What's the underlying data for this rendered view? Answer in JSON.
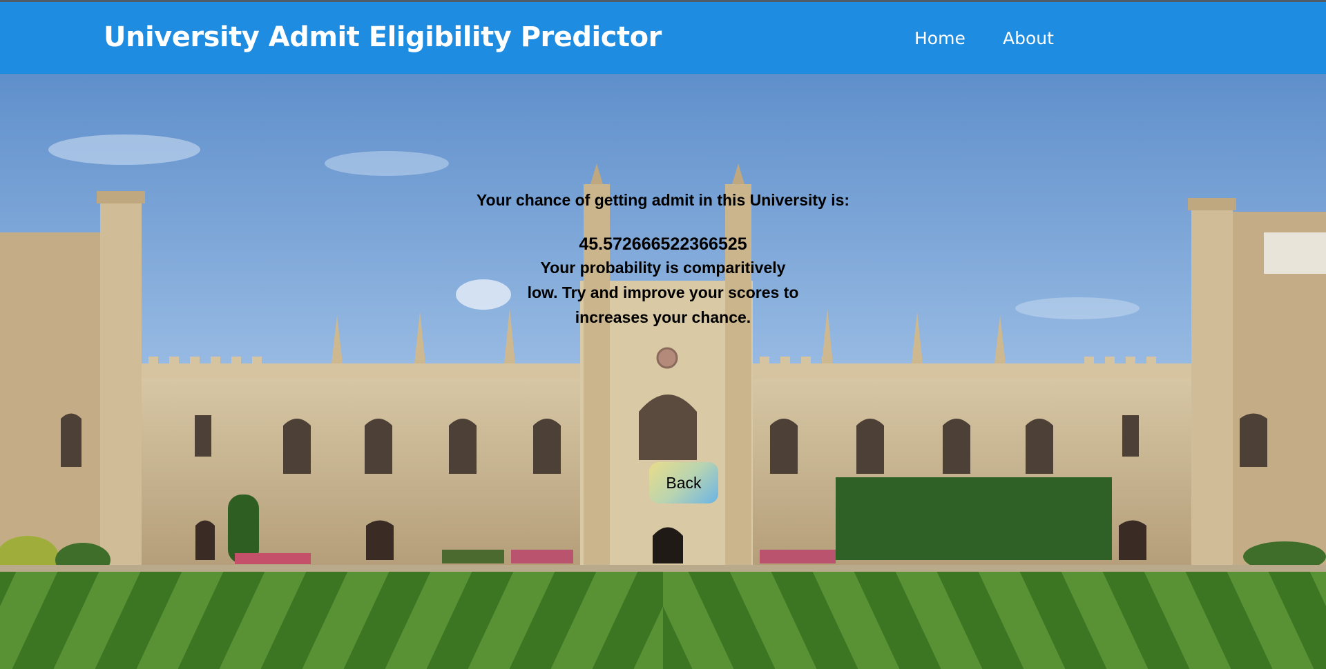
{
  "header": {
    "title": "University Admit Eligibility Predictor",
    "nav": [
      {
        "label": "Home"
      },
      {
        "label": "About"
      }
    ],
    "background_color": "#1e8ce0"
  },
  "result": {
    "heading": "Your chance of getting admit in this University is:",
    "value": "45.572666522366525",
    "message": "Your probability is comparitively low. Try and improve your scores to increases your chance."
  },
  "actions": {
    "back_label": "Back"
  },
  "background": {
    "icon": "university-courtyard-photo",
    "sky_color": "#6f9fd6",
    "stone_color": "#c9b48e",
    "lawn_color": "#5a8f35"
  }
}
